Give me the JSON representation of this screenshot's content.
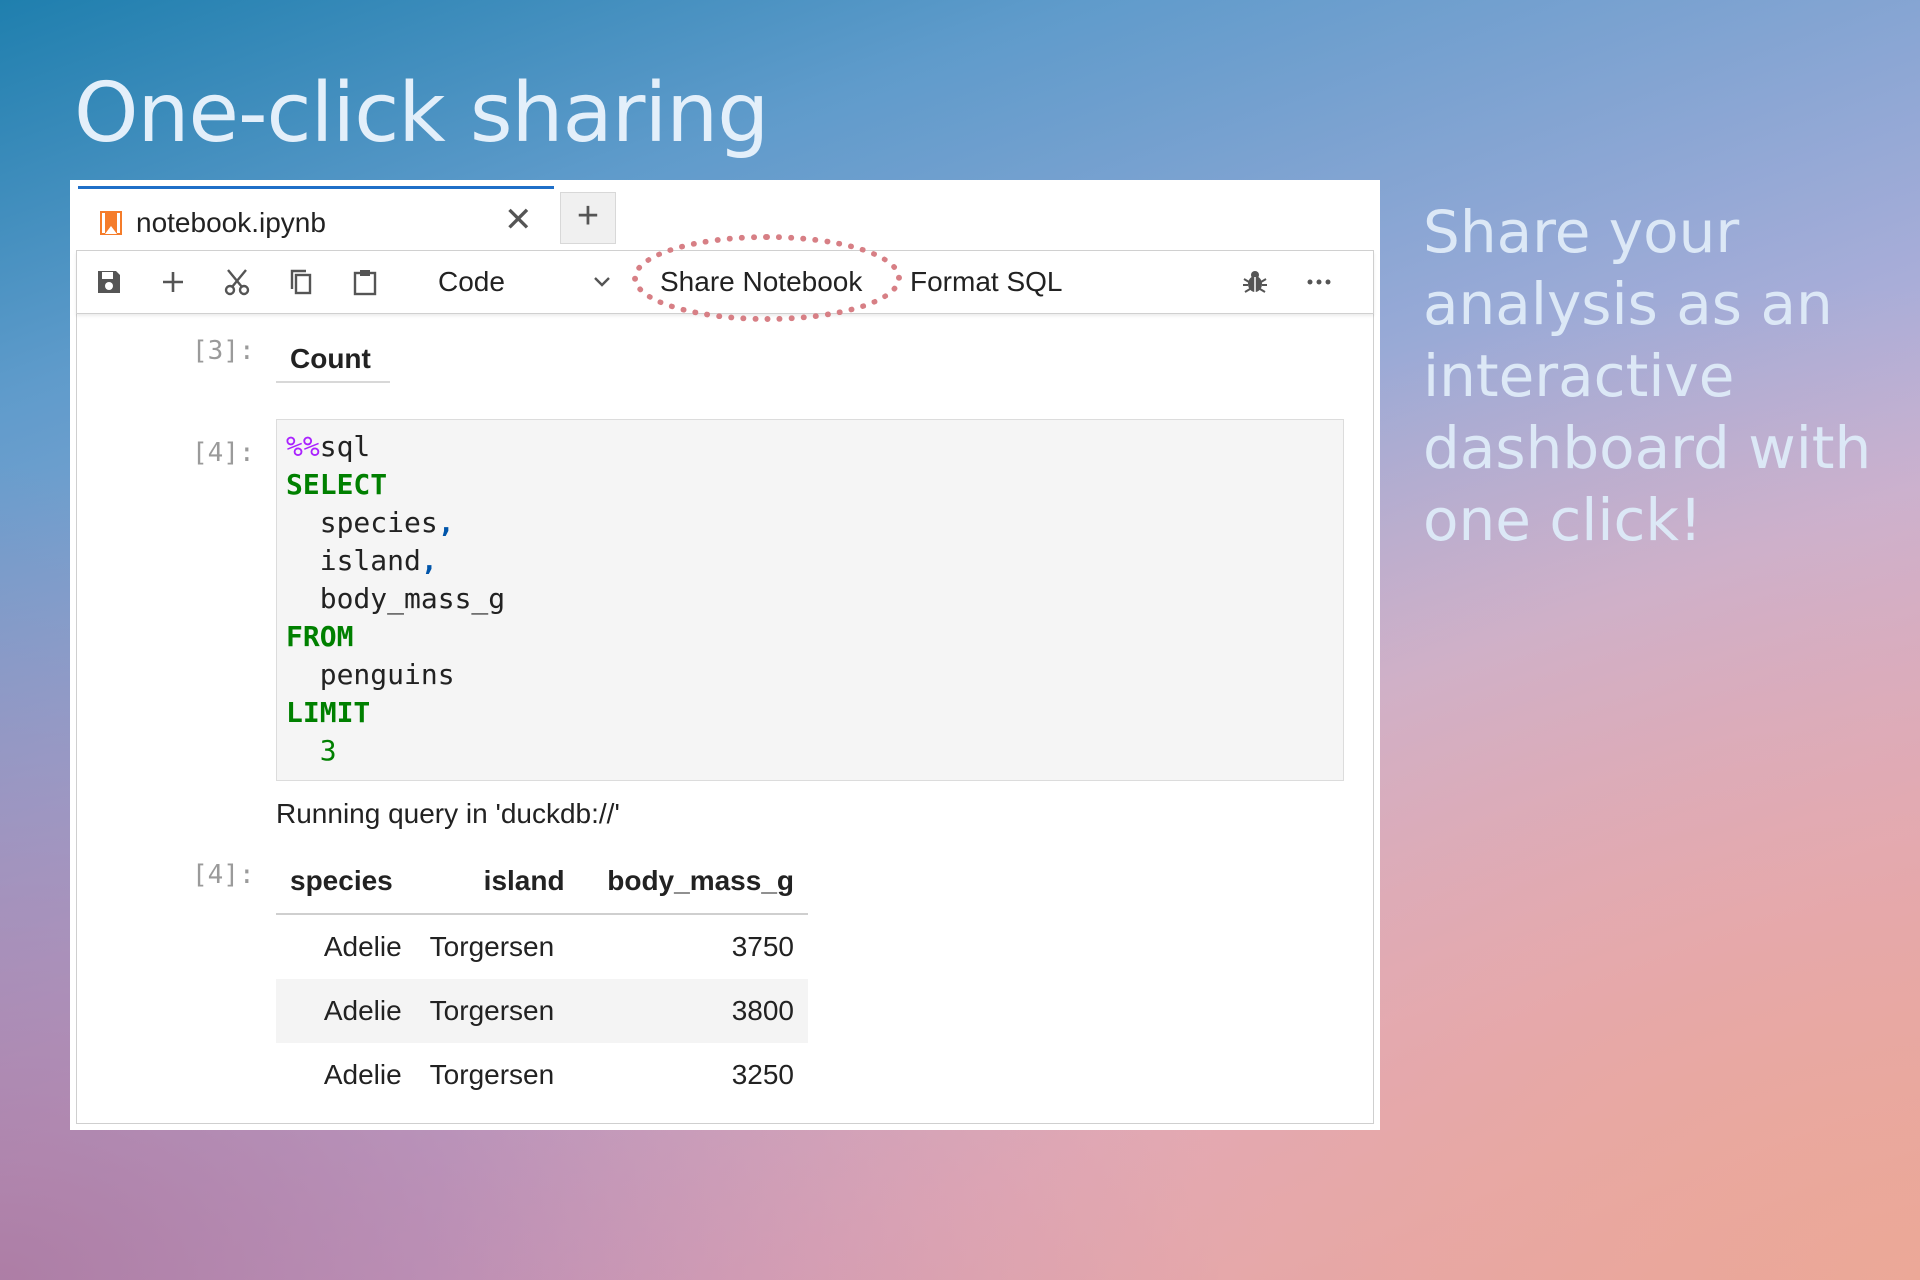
{
  "slide": {
    "title": "One-click sharing",
    "side_text": "Share your analysis as an interactive dashboard with one click!"
  },
  "tab": {
    "filename": "notebook.ipynb",
    "icon": "notebook-icon",
    "close_symbol": "✕",
    "new_tab_symbol": "+"
  },
  "toolbar": {
    "cell_type": "Code",
    "share_label": "Share Notebook",
    "format_label": "Format SQL",
    "icons": [
      "save-icon",
      "add-icon",
      "cut-icon",
      "copy-icon",
      "paste-icon",
      "chevron-down-icon",
      "bug-icon",
      "more-icon"
    ],
    "highlight_color": "#d77f85"
  },
  "cells": {
    "count_prompt": "[3]:",
    "count_label": "Count",
    "code_prompt": "[4]:",
    "code_lines": [
      {
        "parts": [
          {
            "t": "%%",
            "c": "k-magic"
          },
          {
            "t": "sql",
            "c": ""
          }
        ]
      },
      {
        "parts": [
          {
            "t": "SELECT",
            "c": "k-kw"
          }
        ]
      },
      {
        "parts": [
          {
            "t": "  species",
            "c": ""
          },
          {
            "t": ",",
            "c": "k-punct"
          }
        ]
      },
      {
        "parts": [
          {
            "t": "  island",
            "c": ""
          },
          {
            "t": ",",
            "c": "k-punct"
          }
        ]
      },
      {
        "parts": [
          {
            "t": "  body_mass_g",
            "c": ""
          }
        ]
      },
      {
        "parts": [
          {
            "t": "FROM",
            "c": "k-kw"
          }
        ]
      },
      {
        "parts": [
          {
            "t": "  penguins",
            "c": ""
          }
        ]
      },
      {
        "parts": [
          {
            "t": "LIMIT",
            "c": "k-kw"
          }
        ]
      },
      {
        "parts": [
          {
            "t": "  3",
            "c": "k-num"
          }
        ]
      }
    ],
    "running_text": "Running query in 'duckdb://'",
    "output_prompt": "[4]:",
    "table": {
      "headers": [
        "species",
        "island",
        "body_mass_g"
      ],
      "rows": [
        [
          "Adelie",
          "Torgersen",
          "3750"
        ],
        [
          "Adelie",
          "Torgersen",
          "3800"
        ],
        [
          "Adelie",
          "Torgersen",
          "3250"
        ]
      ]
    }
  }
}
